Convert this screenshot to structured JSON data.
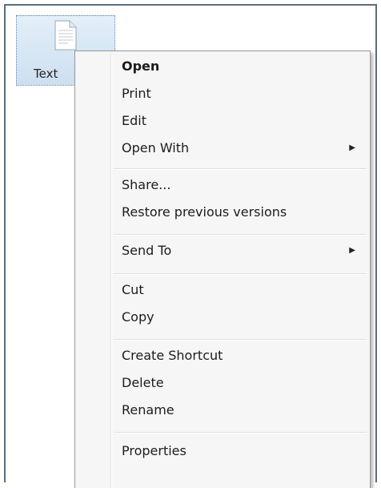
{
  "desktop": {
    "file": {
      "label": "Text",
      "icon": "text-document-icon"
    }
  },
  "context_menu": {
    "open": "Open",
    "print": "Print",
    "edit": "Edit",
    "open_with": "Open With",
    "share": "Share...",
    "restore_previous_versions": "Restore previous versions",
    "send_to": "Send To",
    "cut": "Cut",
    "copy": "Copy",
    "create_shortcut": "Create Shortcut",
    "delete": "Delete",
    "rename": "Rename",
    "properties": "Properties",
    "submenu_arrow": "▶"
  },
  "colors": {
    "selection": "#cddff0",
    "menu_background": "#f6f6f6",
    "window_border": "#5b6d7a"
  }
}
